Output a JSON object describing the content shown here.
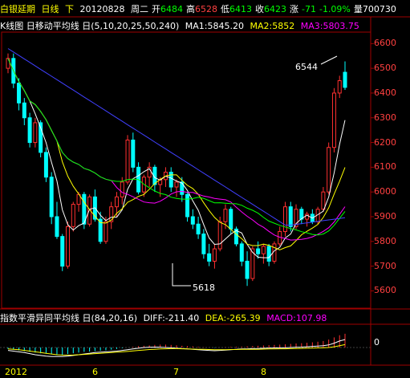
{
  "header": {
    "name": "白银延期",
    "period": "日线",
    "direction": "下",
    "date": "20120828",
    "weekday": "周二",
    "open_label": "开",
    "open": "6484",
    "high_label": "高",
    "high": "6528",
    "low_label": "低",
    "low": "6413",
    "close_label": "收",
    "close": "6423",
    "change_label": "涨",
    "change": "-71",
    "change_pct": "-1.09%",
    "volume_label": "量",
    "volume": "700730"
  },
  "ma_bar": {
    "title": "K线图",
    "indicator": "日移动平均线",
    "params": "日(5,10,20,25,50,240)",
    "ma1": "MA1:5845.20",
    "ma2": "MA2:5852",
    "ma3": "MA3:5803.75"
  },
  "macd_bar": {
    "indicator": "指数平滑异同平均线",
    "params": "日(84,20,16)",
    "diff": "DIFF:-211.40",
    "dea": "DEA:-265.39",
    "macd": "MACD:107.98"
  },
  "annotations": {
    "high_mark": "6544",
    "low_mark": "5618"
  },
  "y_axis": [
    "6600",
    "6500",
    "6400",
    "6300",
    "6200",
    "6100",
    "6000",
    "5900",
    "5800",
    "5700",
    "5600"
  ],
  "macd_axis_zero": "0",
  "x_axis": [
    "2012",
    "6",
    "7",
    "8"
  ],
  "colors": {
    "up": "#ff3030",
    "down": "#00ffff",
    "ma1": "#ffffff",
    "ma2": "#ffff00",
    "ma3": "#ff00ff",
    "ma4": "#00ff00",
    "ma5": "#4040ff",
    "grid": "#a00000"
  },
  "chart_data": {
    "type": "candlestick",
    "ylim": [
      5530,
      6640
    ],
    "candles": [
      [
        6500,
        6560,
        6480,
        6540
      ],
      [
        6540,
        6560,
        6420,
        6440
      ],
      [
        6440,
        6460,
        6330,
        6360
      ],
      [
        6360,
        6380,
        6270,
        6300
      ],
      [
        6300,
        6320,
        6180,
        6200
      ],
      [
        6200,
        6300,
        6180,
        6280
      ],
      [
        6280,
        6290,
        6140,
        6160
      ],
      [
        6160,
        6180,
        6040,
        6060
      ],
      [
        6060,
        6080,
        5870,
        5900
      ],
      [
        5900,
        5960,
        5810,
        5820
      ],
      [
        5820,
        5830,
        5680,
        5700
      ],
      [
        5700,
        5880,
        5690,
        5860
      ],
      [
        5860,
        5960,
        5840,
        5950
      ],
      [
        5950,
        6000,
        5920,
        5990
      ],
      [
        5990,
        6000,
        5850,
        5870
      ],
      [
        5870,
        5990,
        5860,
        5980
      ],
      [
        5980,
        6010,
        5880,
        5890
      ],
      [
        5890,
        5920,
        5790,
        5800
      ],
      [
        5800,
        5900,
        5790,
        5880
      ],
      [
        5880,
        5960,
        5850,
        5940
      ],
      [
        5940,
        6000,
        5900,
        5980
      ],
      [
        5980,
        6060,
        5950,
        6040
      ],
      [
        6040,
        6230,
        6030,
        6210
      ],
      [
        6210,
        6240,
        6080,
        6100
      ],
      [
        6100,
        6120,
        5990,
        6000
      ],
      [
        6000,
        6070,
        5980,
        6060
      ],
      [
        6060,
        6120,
        6020,
        6100
      ],
      [
        6100,
        6110,
        6000,
        6030
      ],
      [
        6030,
        6060,
        5980,
        6050
      ],
      [
        6050,
        6100,
        6020,
        6080
      ],
      [
        6080,
        6100,
        6000,
        6020
      ],
      [
        6020,
        6050,
        5980,
        6040
      ],
      [
        6040,
        6060,
        5960,
        5990
      ],
      [
        5990,
        6000,
        5880,
        5900
      ],
      [
        5900,
        5930,
        5850,
        5870
      ],
      [
        5870,
        5900,
        5810,
        5830
      ],
      [
        5830,
        5850,
        5730,
        5750
      ],
      [
        5750,
        5790,
        5700,
        5720
      ],
      [
        5720,
        5790,
        5690,
        5770
      ],
      [
        5770,
        5900,
        5760,
        5880
      ],
      [
        5880,
        5950,
        5850,
        5930
      ],
      [
        5930,
        5940,
        5830,
        5850
      ],
      [
        5850,
        5860,
        5780,
        5790
      ],
      [
        5790,
        5800,
        5700,
        5720
      ],
      [
        5720,
        5760,
        5620,
        5650
      ],
      [
        5650,
        5780,
        5640,
        5770
      ],
      [
        5770,
        5800,
        5730,
        5750
      ],
      [
        5750,
        5790,
        5710,
        5780
      ],
      [
        5780,
        5790,
        5700,
        5720
      ],
      [
        5720,
        5800,
        5710,
        5790
      ],
      [
        5790,
        5860,
        5780,
        5840
      ],
      [
        5840,
        5960,
        5820,
        5940
      ],
      [
        5940,
        5960,
        5840,
        5860
      ],
      [
        5860,
        5950,
        5850,
        5930
      ],
      [
        5930,
        5940,
        5870,
        5890
      ],
      [
        5890,
        5920,
        5860,
        5910
      ],
      [
        5910,
        5930,
        5870,
        5880
      ],
      [
        5880,
        5940,
        5870,
        5930
      ],
      [
        5930,
        6020,
        5920,
        6000
      ],
      [
        6000,
        6200,
        5990,
        6180
      ],
      [
        6180,
        6420,
        6160,
        6400
      ],
      [
        6400,
        6470,
        6380,
        6450
      ],
      [
        6484,
        6528,
        6413,
        6423
      ]
    ]
  },
  "macd_data": {
    "ylim": [
      -1,
      1
    ],
    "bars": [
      -0.1,
      -0.15,
      -0.2,
      -0.25,
      -0.3,
      -0.35,
      -0.4,
      -0.42,
      -0.45,
      -0.48,
      -0.5,
      -0.45,
      -0.4,
      -0.35,
      -0.3,
      -0.28,
      -0.25,
      -0.22,
      -0.2,
      -0.15,
      -0.1,
      -0.05,
      0.0,
      0.05,
      0.1,
      0.12,
      0.15,
      0.18,
      0.2,
      0.2,
      0.18,
      0.15,
      0.12,
      0.1,
      0.08,
      0.05,
      0.02,
      0.0,
      -0.02,
      0.0,
      0.02,
      0.04,
      0.05,
      0.06,
      0.08,
      0.1,
      0.12,
      0.14,
      0.16,
      0.18,
      0.2,
      0.22,
      0.25,
      0.28,
      0.3,
      0.33,
      0.36,
      0.4,
      0.45,
      0.55,
      0.7,
      0.85,
      0.95
    ],
    "diff": [
      -0.2,
      -0.25,
      -0.3,
      -0.35,
      -0.42,
      -0.5,
      -0.55,
      -0.6,
      -0.62,
      -0.63,
      -0.62,
      -0.6,
      -0.55,
      -0.5,
      -0.45,
      -0.4,
      -0.35,
      -0.32,
      -0.3,
      -0.28,
      -0.25,
      -0.2,
      -0.15,
      -0.1,
      -0.05,
      0.0,
      0.02,
      0.03,
      0.02,
      0.0,
      -0.02,
      -0.05,
      -0.08,
      -0.1,
      -0.13,
      -0.15,
      -0.18,
      -0.2,
      -0.22,
      -0.2,
      -0.18,
      -0.15,
      -0.12,
      -0.1,
      -0.1,
      -0.08,
      -0.07,
      -0.05,
      -0.04,
      -0.03,
      -0.02,
      -0.02,
      0.0,
      0.02,
      0.03,
      0.05,
      0.08,
      0.1,
      0.12,
      0.18,
      0.3,
      0.45,
      0.55
    ],
    "dea": [
      -0.1,
      -0.12,
      -0.15,
      -0.2,
      -0.25,
      -0.3,
      -0.35,
      -0.4,
      -0.45,
      -0.5,
      -0.52,
      -0.53,
      -0.52,
      -0.5,
      -0.48,
      -0.45,
      -0.42,
      -0.4,
      -0.38,
      -0.35,
      -0.32,
      -0.3,
      -0.27,
      -0.24,
      -0.2,
      -0.17,
      -0.14,
      -0.12,
      -0.1,
      -0.09,
      -0.08,
      -0.08,
      -0.09,
      -0.1,
      -0.11,
      -0.12,
      -0.13,
      -0.14,
      -0.15,
      -0.15,
      -0.15,
      -0.14,
      -0.14,
      -0.13,
      -0.13,
      -0.12,
      -0.12,
      -0.11,
      -0.1,
      -0.1,
      -0.09,
      -0.09,
      -0.08,
      -0.07,
      -0.06,
      -0.05,
      -0.04,
      -0.03,
      -0.02,
      0.0,
      0.05,
      0.12,
      0.2
    ]
  }
}
